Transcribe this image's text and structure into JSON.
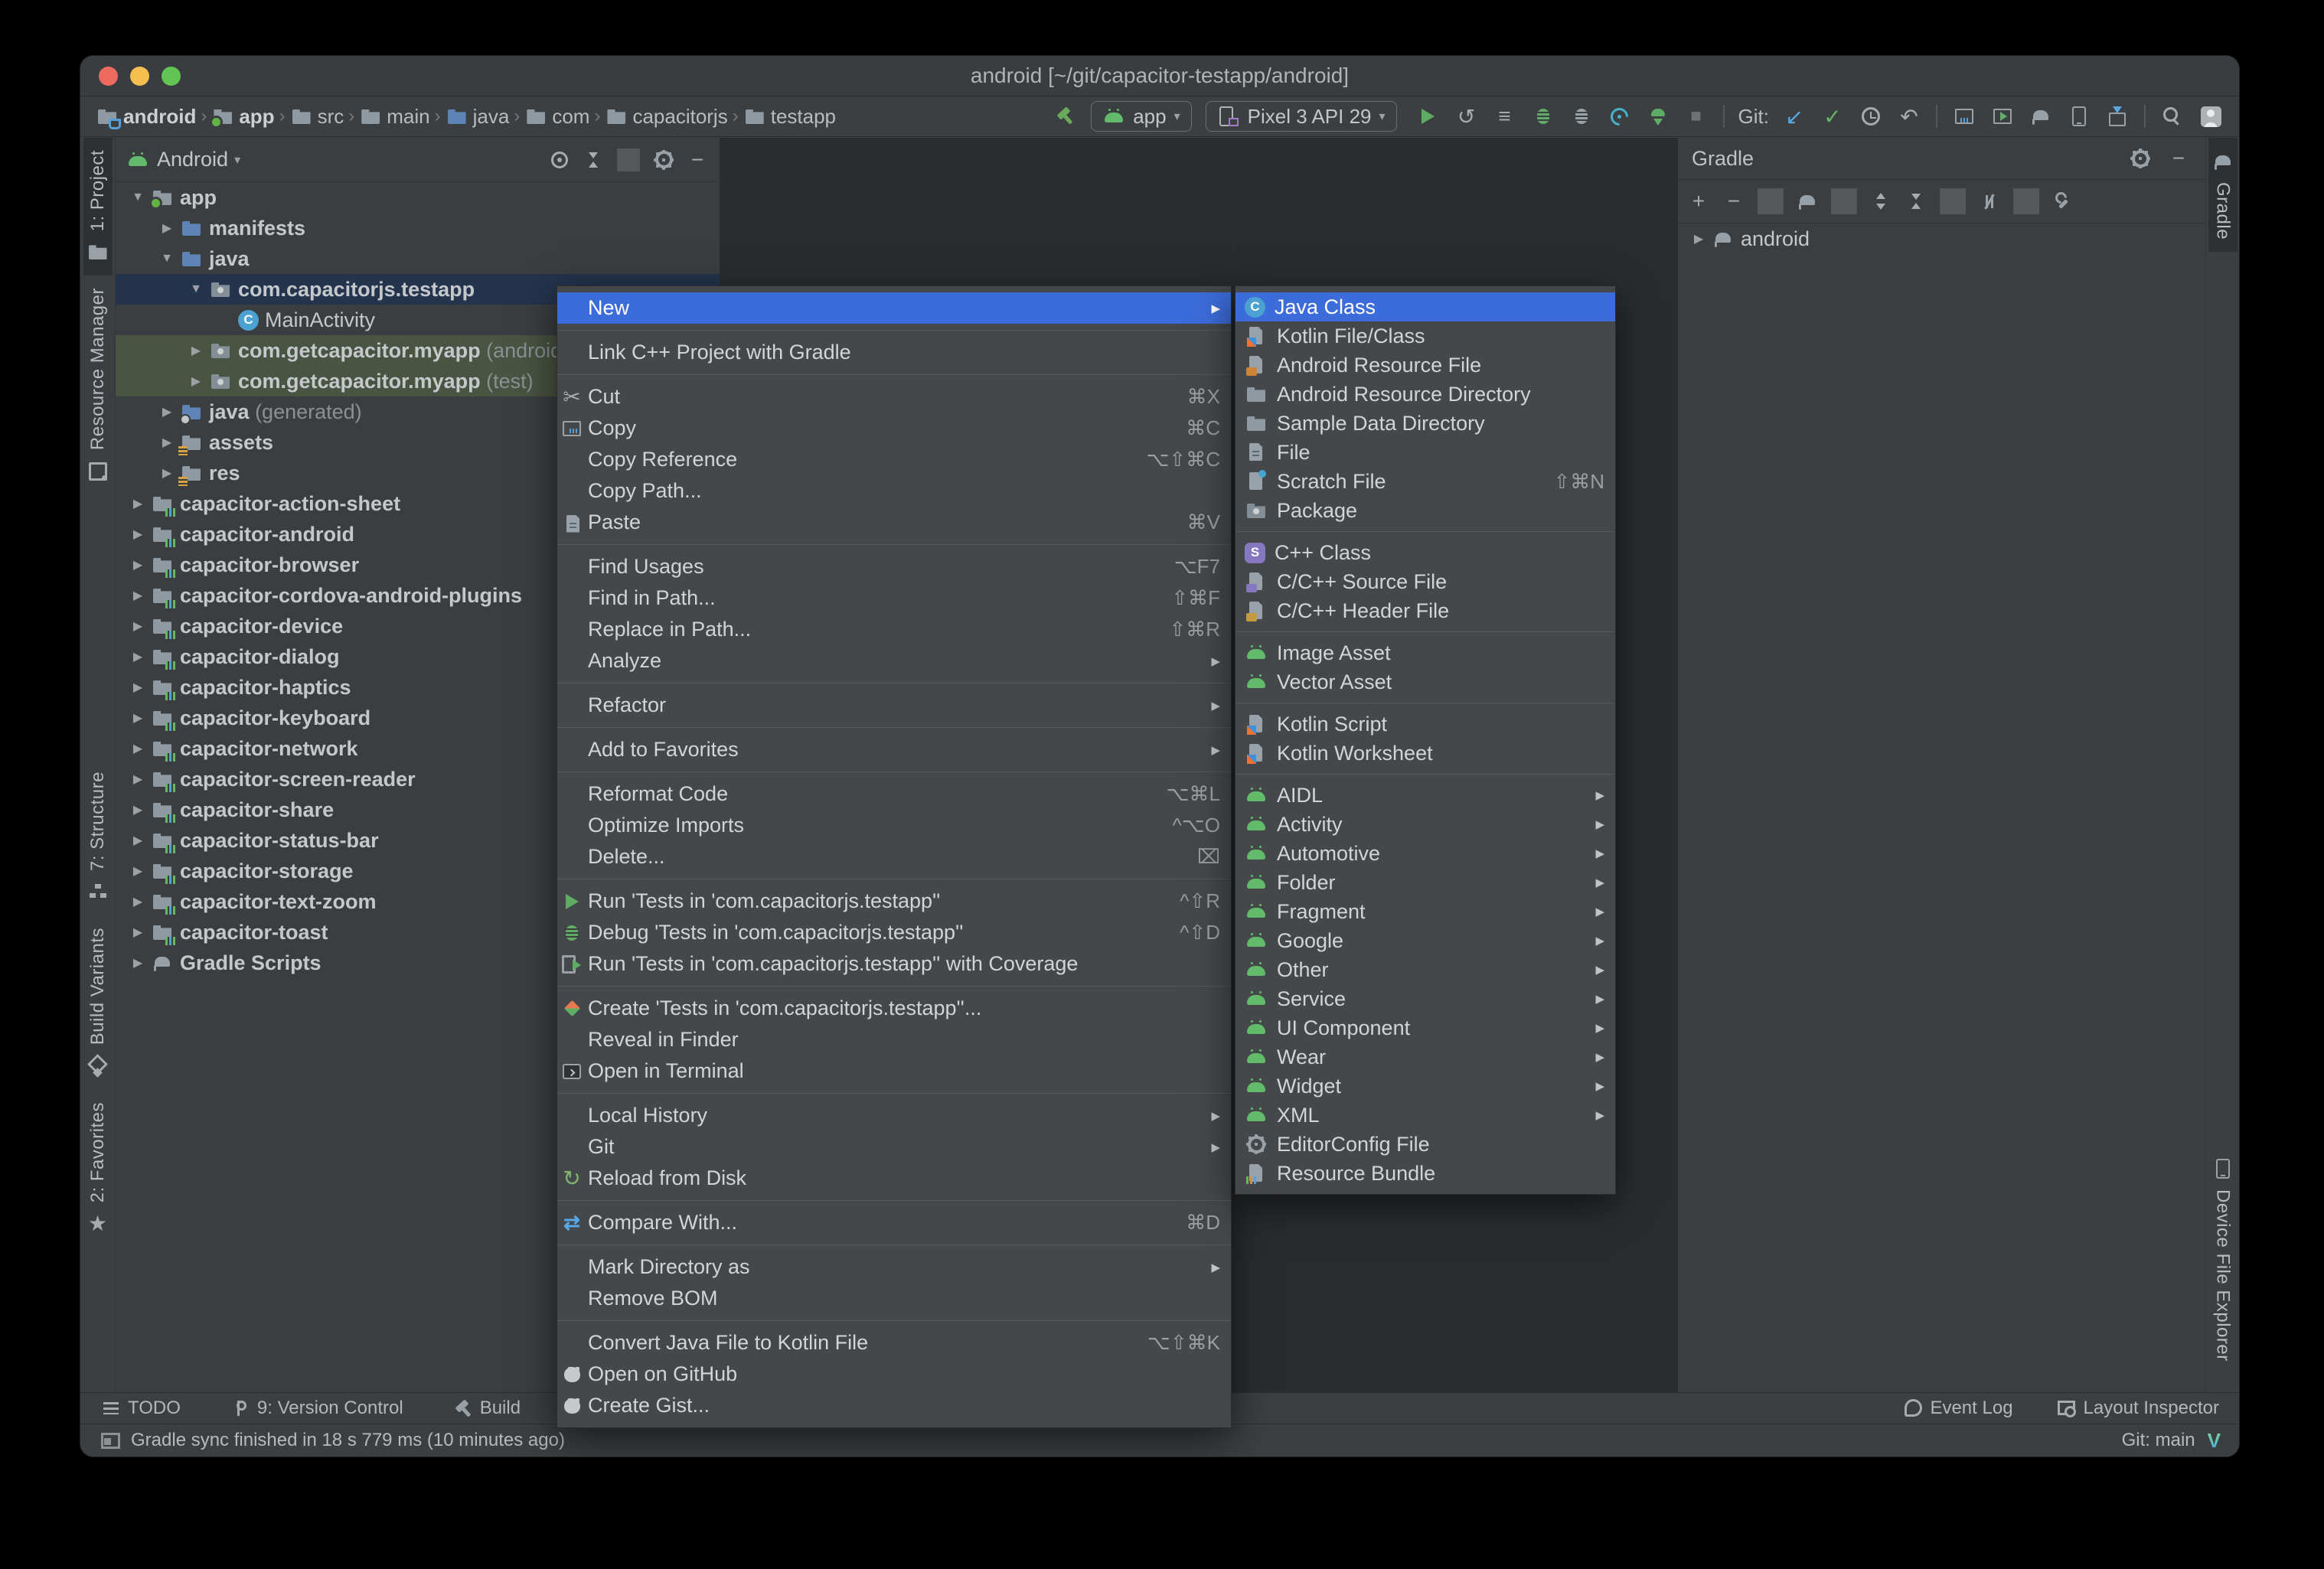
{
  "window": {
    "title": "android [~/git/capacitor-testapp/android]"
  },
  "ui": {
    "chevron": "▾"
  },
  "toolbar": {
    "run_config": "app",
    "device": "Pixel 3 API 29",
    "breadcrumbs": [
      {
        "label": "android",
        "icon": "folder-cup",
        "bold": true,
        "name": "breadcrumb-android"
      },
      {
        "label": "›",
        "sep": true
      },
      {
        "label": "app",
        "icon": "folder-app",
        "bold": true,
        "name": "breadcrumb-app"
      },
      {
        "label": "›",
        "sep": true
      },
      {
        "label": "src",
        "icon": "folder",
        "name": "breadcrumb-src"
      },
      {
        "label": "›",
        "sep": true
      },
      {
        "label": "main",
        "icon": "folder",
        "name": "breadcrumb-main"
      },
      {
        "label": "›",
        "sep": true
      },
      {
        "label": "java",
        "icon": "folder-blue",
        "name": "breadcrumb-java"
      },
      {
        "label": "›",
        "sep": true
      },
      {
        "label": "com",
        "icon": "folder",
        "name": "breadcrumb-com"
      },
      {
        "label": "›",
        "sep": true
      },
      {
        "label": "capacitorjs",
        "icon": "folder",
        "name": "breadcrumb-capacitorjs"
      },
      {
        "label": "›",
        "sep": true
      },
      {
        "label": "testapp",
        "icon": "folder",
        "name": "breadcrumb-testapp"
      }
    ],
    "actions": [
      {
        "name": "run-button",
        "icon": "play"
      },
      {
        "name": "rerun-button",
        "icon": "g-grey",
        "glyph": "↺"
      },
      {
        "name": "run-configurations-button",
        "icon": "g-grey",
        "glyph": "≡"
      },
      {
        "name": "debug-button",
        "icon": "bug"
      },
      {
        "name": "attach-debugger-button",
        "icon": "bug-grey"
      },
      {
        "name": "profiler-button",
        "icon": "profiler"
      },
      {
        "name": "apply-changes-button",
        "icon": "apply"
      },
      {
        "name": "stop-button",
        "icon": "g-dim",
        "glyph": "■"
      },
      {
        "divider": true
      },
      {
        "name": "git-label",
        "text": true,
        "label": "Git:"
      },
      {
        "name": "update-project-button",
        "icon": "g-blue",
        "glyph": "↙"
      },
      {
        "name": "commit-button",
        "icon": "g-green",
        "glyph": "✓"
      },
      {
        "name": "history-button",
        "icon": "clock"
      },
      {
        "name": "rollback-button",
        "icon": "g-grey",
        "glyph": "↶"
      },
      {
        "divider": true
      },
      {
        "name": "build-variants-button",
        "icon": "winbars"
      },
      {
        "name": "run-anything-button",
        "icon": "winplay"
      },
      {
        "name": "gradle-sync-button",
        "icon": "elephant"
      },
      {
        "name": "device-manager-button",
        "icon": "phone"
      },
      {
        "name": "sdk-manager-button",
        "icon": "sdkbox"
      },
      {
        "divider": true
      },
      {
        "name": "search-everywhere-button",
        "icon": "search"
      },
      {
        "name": "profile-avatar",
        "icon": "avatar"
      }
    ]
  },
  "left_strip": {
    "top": [
      {
        "label": "1: Project",
        "icon": "project",
        "active": true,
        "name": "tool-tab-project"
      },
      {
        "label": "Resource Manager",
        "icon": "resmgr",
        "name": "tool-tab-resource-manager"
      }
    ],
    "bottom": [
      {
        "label": "7: Structure",
        "icon": "structure",
        "name": "tool-tab-structure"
      },
      {
        "label": "Build Variants",
        "icon": "variants",
        "name": "tool-tab-build-variants"
      },
      {
        "label": "2: Favorites",
        "icon": "g-grey",
        "glyph": "★",
        "name": "tool-tab-favorites"
      }
    ]
  },
  "right_strip": {
    "top": [
      {
        "label": "Gradle",
        "icon": "elephant",
        "active": true,
        "name": "tool-tab-gradle"
      }
    ],
    "bottom": [
      {
        "label": "Device File Explorer",
        "icon": "phone",
        "name": "tool-tab-device-file-explorer"
      }
    ]
  },
  "project_panel": {
    "header": {
      "title": "Android",
      "icons": [
        {
          "name": "locate-file-button",
          "icon": "target"
        },
        {
          "name": "collapse-all-button",
          "icon": "collapse"
        },
        {
          "divider": true
        },
        {
          "name": "panel-options-button",
          "icon": "gear"
        },
        {
          "name": "hide-panel-button",
          "icon": "g-grey",
          "glyph": "−"
        }
      ]
    },
    "tree": [
      {
        "label": "app",
        "icon": "folder-app",
        "indent": 0,
        "twisty": "▼",
        "bold": true,
        "name": "tree-row-app"
      },
      {
        "label": "manifests",
        "icon": "folder-blue",
        "indent": 1,
        "twisty": "▶",
        "bold": true
      },
      {
        "label": "java",
        "icon": "folder-blue",
        "indent": 1,
        "twisty": "▼",
        "bold": true
      },
      {
        "label": "com.capacitorjs.testapp",
        "icon": "package",
        "indent": 2,
        "twisty": "▼",
        "bold": true,
        "state": "selected",
        "name": "tree-row-selected-package"
      },
      {
        "label": "MainActivity",
        "icon": "class",
        "glyph": "C",
        "indent": 3,
        "twisty": ""
      },
      {
        "label": "com.getcapacitor.myapp",
        "suffix": " (androidTest)",
        "icon": "package",
        "indent": 2,
        "twisty": "▶",
        "bold": true,
        "state": "test"
      },
      {
        "label": "com.getcapacitor.myapp",
        "suffix": " (test)",
        "icon": "package",
        "indent": 2,
        "twisty": "▶",
        "bold": true,
        "state": "test"
      },
      {
        "label": "java",
        "suffix": " (generated)",
        "icon": "folder-gen",
        "indent": 1,
        "twisty": "▶",
        "bold": true
      },
      {
        "label": "assets",
        "icon": "folder-res",
        "indent": 1,
        "twisty": "▶",
        "bold": true
      },
      {
        "label": "res",
        "icon": "folder-res",
        "indent": 1,
        "twisty": "▶",
        "bold": true
      },
      {
        "label": "capacitor-action-sheet",
        "icon": "module",
        "indent": 0,
        "twisty": "▶",
        "bold": true
      },
      {
        "label": "capacitor-android",
        "icon": "module",
        "indent": 0,
        "twisty": "▶",
        "bold": true
      },
      {
        "label": "capacitor-browser",
        "icon": "module",
        "indent": 0,
        "twisty": "▶",
        "bold": true
      },
      {
        "label": "capacitor-cordova-android-plugins",
        "icon": "module",
        "indent": 0,
        "twisty": "▶",
        "bold": true
      },
      {
        "label": "capacitor-device",
        "icon": "module",
        "indent": 0,
        "twisty": "▶",
        "bold": true
      },
      {
        "label": "capacitor-dialog",
        "icon": "module",
        "indent": 0,
        "twisty": "▶",
        "bold": true
      },
      {
        "label": "capacitor-haptics",
        "icon": "module",
        "indent": 0,
        "twisty": "▶",
        "bold": true
      },
      {
        "label": "capacitor-keyboard",
        "icon": "module",
        "indent": 0,
        "twisty": "▶",
        "bold": true
      },
      {
        "label": "capacitor-network",
        "icon": "module",
        "indent": 0,
        "twisty": "▶",
        "bold": true
      },
      {
        "label": "capacitor-screen-reader",
        "icon": "module",
        "indent": 0,
        "twisty": "▶",
        "bold": true
      },
      {
        "label": "capacitor-share",
        "icon": "module",
        "indent": 0,
        "twisty": "▶",
        "bold": true
      },
      {
        "label": "capacitor-status-bar",
        "icon": "module",
        "indent": 0,
        "twisty": "▶",
        "bold": true
      },
      {
        "label": "capacitor-storage",
        "icon": "module",
        "indent": 0,
        "twisty": "▶",
        "bold": true
      },
      {
        "label": "capacitor-text-zoom",
        "icon": "module",
        "indent": 0,
        "twisty": "▶",
        "bold": true
      },
      {
        "label": "capacitor-toast",
        "icon": "module",
        "indent": 0,
        "twisty": "▶",
        "bold": true
      },
      {
        "label": "Gradle Scripts",
        "icon": "elephant",
        "indent": 0,
        "twisty": "▶",
        "bold": true
      }
    ]
  },
  "gradle_panel": {
    "title": "Gradle",
    "header_icons": [
      {
        "name": "gradle-options-button",
        "icon": "gear"
      },
      {
        "name": "hide-gradle-panel-button",
        "icon": "g-grey",
        "glyph": "−"
      }
    ],
    "toolbar": [
      {
        "name": "add-gradle-project-button",
        "icon": "g-grey",
        "glyph": "+"
      },
      {
        "name": "remove-gradle-project-button",
        "icon": "g-grey",
        "glyph": "−"
      },
      {
        "divider": true
      },
      {
        "name": "refresh-gradle-button",
        "icon": "elephant"
      },
      {
        "divider": true
      },
      {
        "name": "expand-all-button",
        "icon": "expand"
      },
      {
        "name": "collapse-all-button",
        "icon": "collapse"
      },
      {
        "divider": true
      },
      {
        "name": "offline-mode-button",
        "icon": "offline"
      },
      {
        "divider": true
      },
      {
        "name": "gradle-settings-button",
        "icon": "wrench"
      }
    ],
    "tree": [
      {
        "label": "android",
        "icon": "elephant",
        "indent": 0,
        "twisty": "▶",
        "name": "gradle-tree-android"
      }
    ]
  },
  "bottom_bar": {
    "left": [
      {
        "label": "TODO",
        "icon": "todo",
        "name": "todo-button"
      },
      {
        "label": "9: Version Control",
        "icon": "branch",
        "name": "version-control-button"
      },
      {
        "label": "Build",
        "icon": "hammer-grey",
        "name": "build-button"
      }
    ],
    "right": [
      {
        "label": "Event Log",
        "icon": "balloon",
        "name": "event-log-button"
      },
      {
        "label": "Layout Inspector",
        "icon": "layoutinsp",
        "name": "layout-inspector-button"
      }
    ]
  },
  "status_bar": {
    "message": "Gradle sync finished in 18 s 779 ms (10 minutes ago)",
    "git": "Git: main",
    "vim_badge": "V"
  },
  "context_menu": {
    "items": [
      {
        "label": "New",
        "selected": true,
        "sub": "▶",
        "group_end": true,
        "name": "menu-item-new"
      },
      {
        "label": "Link C++ Project with Gradle",
        "group_end": true
      },
      {
        "label": "Cut",
        "icon": "g-grey",
        "glyph": "✂",
        "shortcut": "⌘X"
      },
      {
        "label": "Copy",
        "icon": "winbars",
        "shortcut": "⌘C"
      },
      {
        "label": "Copy Reference",
        "shortcut": "⌥⇧⌘C"
      },
      {
        "label": "Copy Path..."
      },
      {
        "label": "Paste",
        "icon": "file",
        "shortcut": "⌘V",
        "group_end": true
      },
      {
        "label": "Find Usages",
        "shortcut": "⌥F7"
      },
      {
        "label": "Find in Path...",
        "shortcut": "⇧⌘F"
      },
      {
        "label": "Replace in Path...",
        "shortcut": "⇧⌘R"
      },
      {
        "label": "Analyze",
        "sub": "▶",
        "group_end": true
      },
      {
        "label": "Refactor",
        "sub": "▶",
        "group_end": true
      },
      {
        "label": "Add to Favorites",
        "sub": "▶",
        "group_end": true
      },
      {
        "label": "Reformat Code",
        "shortcut": "⌥⌘L"
      },
      {
        "label": "Optimize Imports",
        "shortcut": "^⌥O"
      },
      {
        "label": "Delete...",
        "shortcut": "⌧",
        "group_end": true
      },
      {
        "label": "Run 'Tests in 'com.capacitorjs.testapp''",
        "icon": "play",
        "shortcut": "^⇧R"
      },
      {
        "label": "Debug 'Tests in 'com.capacitorjs.testapp''",
        "icon": "bug",
        "shortcut": "^⇧D"
      },
      {
        "label": "Run 'Tests in 'com.capacitorjs.testapp'' with Coverage",
        "icon": "coverage",
        "group_end": true
      },
      {
        "label": "Create 'Tests in 'com.capacitorjs.testapp''...",
        "icon": "create-test"
      },
      {
        "label": "Reveal in Finder"
      },
      {
        "label": "Open in Terminal",
        "icon": "terminal",
        "group_end": true
      },
      {
        "label": "Local History",
        "sub": "▶"
      },
      {
        "label": "Git",
        "sub": "▶"
      },
      {
        "label": "Reload from Disk",
        "icon": "reload",
        "glyph": "↻",
        "group_end": true
      },
      {
        "label": "Compare With...",
        "icon": "compare",
        "glyph": "⇄",
        "shortcut": "⌘D",
        "group_end": true
      },
      {
        "label": "Mark Directory as",
        "sub": "▶"
      },
      {
        "label": "Remove BOM",
        "group_end": true
      },
      {
        "label": "Convert Java File to Kotlin File",
        "shortcut": "⌥⇧⌘K"
      },
      {
        "label": "Open on GitHub",
        "icon": "github"
      },
      {
        "label": "Create Gist...",
        "icon": "github"
      }
    ]
  },
  "submenu": {
    "items": [
      {
        "label": "Java Class",
        "icon": "class",
        "glyph": "C",
        "selected": true,
        "name": "submenu-item-java-class"
      },
      {
        "label": "Kotlin File/Class",
        "icon": "kotlin"
      },
      {
        "label": "Android Resource File",
        "icon": "resfile"
      },
      {
        "label": "Android Resource Directory",
        "icon": "folder"
      },
      {
        "label": "Sample Data Directory",
        "icon": "folder"
      },
      {
        "label": "File",
        "icon": "file"
      },
      {
        "label": "Scratch File",
        "icon": "scratch",
        "shortcut": "⇧⌘N"
      },
      {
        "label": "Package",
        "icon": "package",
        "group_end": true
      },
      {
        "label": "C++ Class",
        "icon": "cppclass",
        "glyph": "S"
      },
      {
        "label": "C/C++ Source File",
        "icon": "cppsrc"
      },
      {
        "label": "C/C++ Header File",
        "icon": "cpph",
        "group_end": true
      },
      {
        "label": "Image Asset",
        "icon": "android"
      },
      {
        "label": "Vector Asset",
        "icon": "android",
        "group_end": true
      },
      {
        "label": "Kotlin Script",
        "icon": "kscript"
      },
      {
        "label": "Kotlin Worksheet",
        "icon": "kscript",
        "group_end": true
      },
      {
        "label": "AIDL",
        "icon": "android",
        "sub": "▶"
      },
      {
        "label": "Activity",
        "icon": "android",
        "sub": "▶"
      },
      {
        "label": "Automotive",
        "icon": "android",
        "sub": "▶"
      },
      {
        "label": "Folder",
        "icon": "android",
        "sub": "▶"
      },
      {
        "label": "Fragment",
        "icon": "android",
        "sub": "▶"
      },
      {
        "label": "Google",
        "icon": "android",
        "sub": "▶"
      },
      {
        "label": "Other",
        "icon": "android",
        "sub": "▶"
      },
      {
        "label": "Service",
        "icon": "android",
        "sub": "▶"
      },
      {
        "label": "UI Component",
        "icon": "android",
        "sub": "▶"
      },
      {
        "label": "Wear",
        "icon": "android",
        "sub": "▶"
      },
      {
        "label": "Widget",
        "icon": "android",
        "sub": "▶"
      },
      {
        "label": "XML",
        "icon": "android",
        "sub": "▶"
      },
      {
        "label": "EditorConfig File",
        "icon": "gear"
      },
      {
        "label": "Resource Bundle",
        "icon": "bundle"
      }
    ]
  }
}
